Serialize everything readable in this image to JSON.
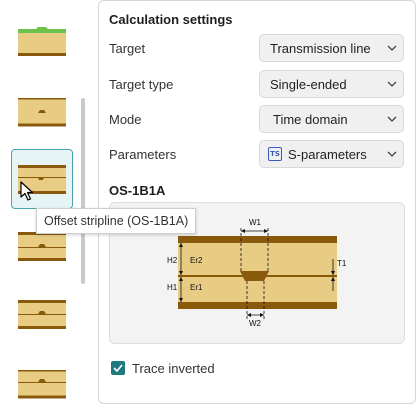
{
  "settings": {
    "title": "Calculation settings",
    "rows": [
      {
        "label": "Target",
        "value": "Transmission line"
      },
      {
        "label": "Target type",
        "value": "Single-ended"
      },
      {
        "label": "Mode",
        "value": "Time domain"
      },
      {
        "label": "Parameters",
        "value": "S-parameters",
        "badge": "TS"
      }
    ]
  },
  "diagram": {
    "title": "OS-1B1A",
    "labels": {
      "w1": "W1",
      "w2": "W2",
      "t1": "T1",
      "h1": "H1",
      "h2": "H2",
      "er1": "Er1",
      "er2": "Er2"
    }
  },
  "checkbox": {
    "label": "Trace inverted",
    "checked": true
  },
  "tooltip": {
    "text": "Offset stripline (OS-1B1A)"
  },
  "colors": {
    "accent": "#1f7a80",
    "selected_bg": "#e6f4f5",
    "copper": "#8a5a0c",
    "dielectric": "#e8cc84",
    "green_mask": "#6cc24a"
  },
  "icons": {
    "chevron": "chevron-down-icon",
    "check": "check-icon",
    "cursor": "arrow-cursor-icon",
    "badge": "touchstone-icon"
  }
}
